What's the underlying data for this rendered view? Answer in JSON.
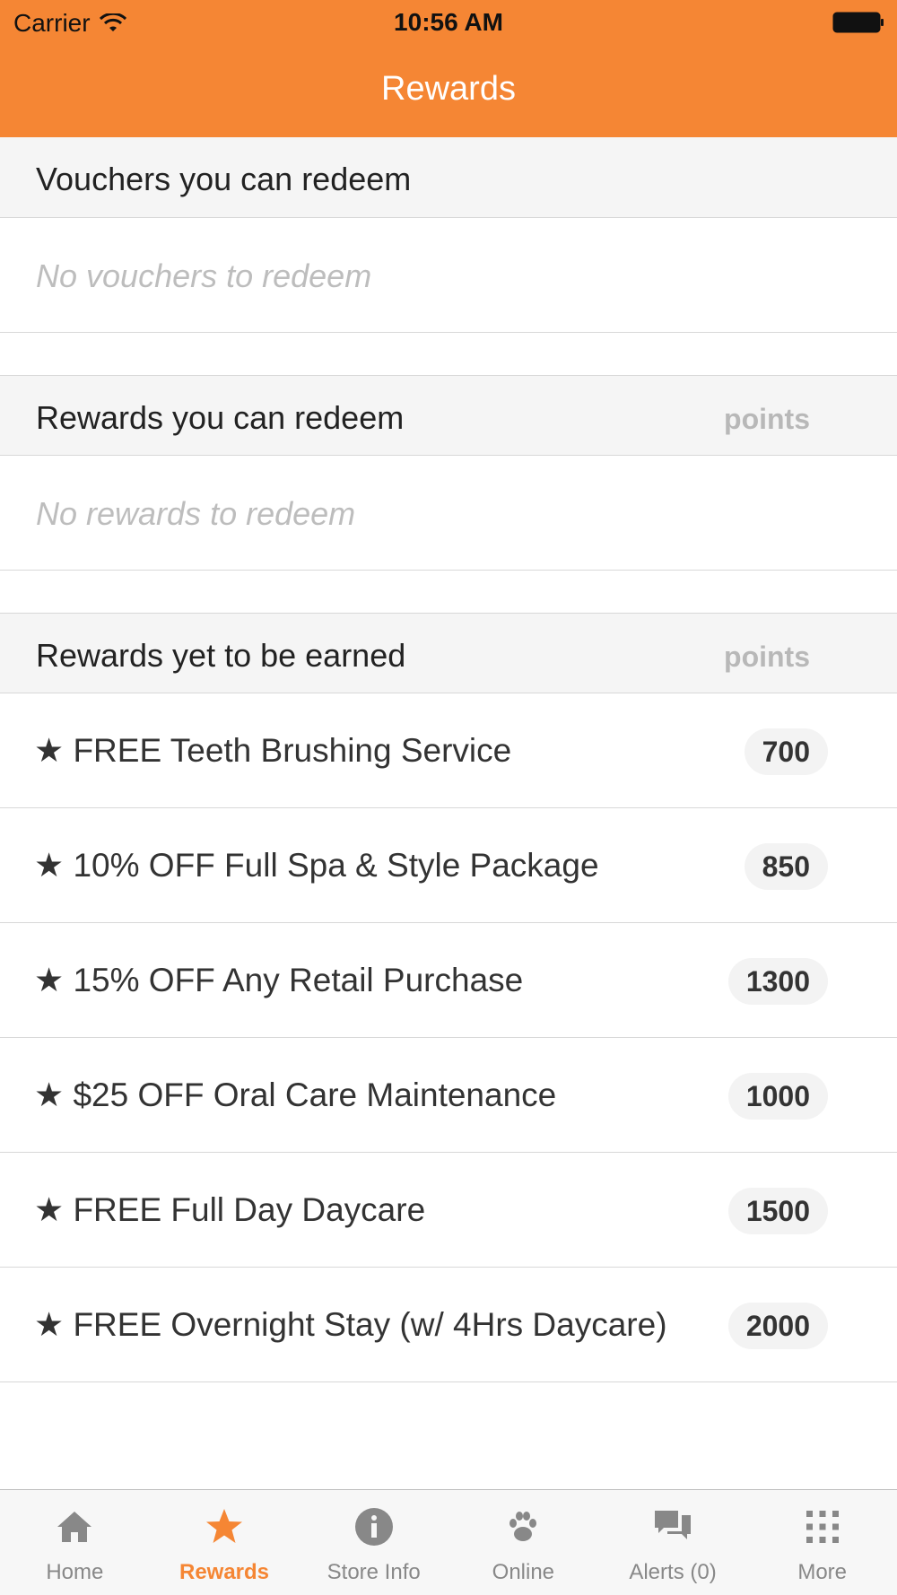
{
  "status_bar": {
    "carrier": "Carrier",
    "time": "10:56 AM"
  },
  "nav": {
    "title": "Rewards"
  },
  "vouchers": {
    "title": "Vouchers you can redeem",
    "empty": "No vouchers to redeem"
  },
  "redeemable": {
    "title": "Rewards you can redeem",
    "points_label": "points",
    "empty": "No rewards to redeem"
  },
  "unearned": {
    "title": "Rewards yet to be earned",
    "points_label": "points",
    "items": [
      {
        "label": "★ FREE Teeth Brushing Service",
        "points": "700"
      },
      {
        "label": "★ 10% OFF Full Spa & Style Package",
        "points": "850"
      },
      {
        "label": "★ 15% OFF Any Retail Purchase",
        "points": "1300"
      },
      {
        "label": "★ $25 OFF Oral Care Maintenance",
        "points": "1000"
      },
      {
        "label": "★ FREE Full Day Daycare",
        "points": "1500"
      },
      {
        "label": "★ FREE Overnight Stay (w/ 4Hrs Daycare)",
        "points": "2000"
      }
    ]
  },
  "tabs": [
    {
      "label": "Home",
      "icon": "home-icon"
    },
    {
      "label": "Rewards",
      "icon": "star-icon",
      "active": true
    },
    {
      "label": "Store Info",
      "icon": "info-icon"
    },
    {
      "label": "Online",
      "icon": "paw-icon"
    },
    {
      "label": "Alerts (0)",
      "icon": "chat-icon"
    },
    {
      "label": "More",
      "icon": "grid-icon"
    }
  ],
  "colors": {
    "accent": "#F58634",
    "inactive_tab": "#888888"
  }
}
